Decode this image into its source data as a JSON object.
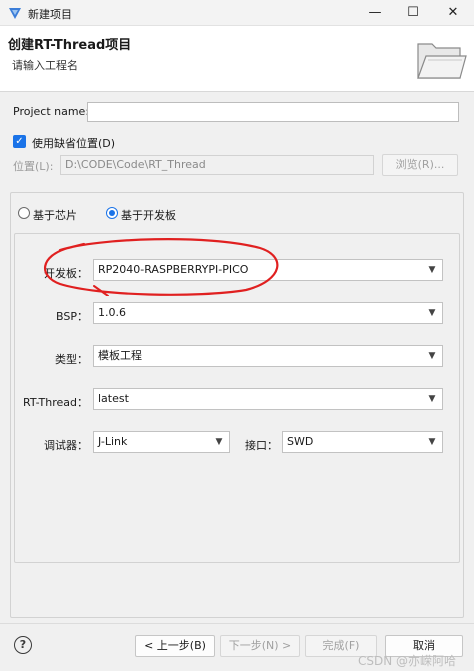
{
  "window": {
    "title": "新建项目",
    "controls": {
      "minimize": "—",
      "maximize": "☐",
      "close": "✕"
    }
  },
  "header": {
    "title": "创建RT-Thread项目",
    "subtitle": "请输入工程名"
  },
  "form": {
    "project_name_label": "Project name:",
    "project_name_value": "",
    "use_default_location_label": "使用缺省位置(D)",
    "use_default_location_checked": true,
    "location_label": "位置(L):",
    "location_value": "D:\\CODE\\Code\\RT_Thread",
    "browse_label": "浏览(R)..."
  },
  "mode": {
    "chip_label": "基于芯片",
    "board_label": "基于开发板",
    "selected": "board"
  },
  "board_settings": {
    "board_label": "开发板：",
    "board_value": "RP2040-RASPBERRYPI-PICO",
    "bsp_label": "BSP：",
    "bsp_value": "1.0.6",
    "type_label": "类型：",
    "type_value": "模板工程",
    "rtthread_label": "RT-Thread：",
    "rtthread_value": "latest",
    "debugger_label": "调试器：",
    "debugger_value": "J-Link",
    "interface_label": "接口：",
    "interface_value": "SWD"
  },
  "annotation": {
    "color": "#e02020"
  },
  "footer": {
    "help_glyph": "?",
    "back_label": "< 上一步(B)",
    "next_label": "下一步(N) >",
    "finish_label": "完成(F)",
    "cancel_label": "取消"
  },
  "watermark": "CSDN @亦嵘阿哈",
  "colors": {
    "accent": "#1a73e8",
    "annotation": "#e02020"
  }
}
